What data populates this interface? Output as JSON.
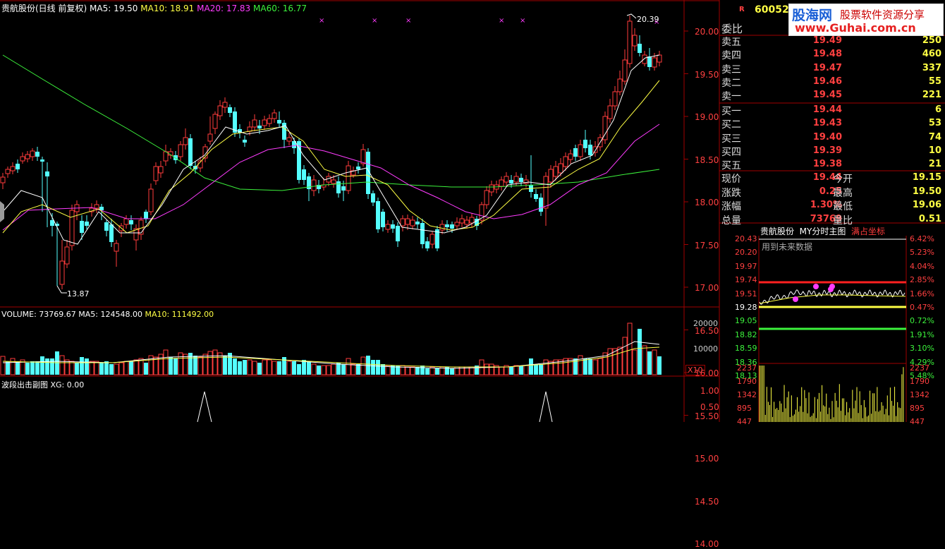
{
  "header": {
    "title": "贵航股份(日线 前复权)",
    "ma5": "MA5: 19.50",
    "ma10": "MA10: 18.91",
    "ma20": "MA20: 17.83",
    "ma60": "MA60: 16.77"
  },
  "price_axis": [
    "20.00",
    "19.50",
    "19.00",
    "18.50",
    "18.00",
    "17.50",
    "17.00",
    "16.50",
    "16.00",
    "15.50",
    "15.00",
    "14.50",
    "14.00"
  ],
  "annotations": {
    "high": "20.39",
    "low": "13.87"
  },
  "volume_header": {
    "volume": "VOLUME: 73769.67",
    "ma5": "MA5: 124548.00",
    "ma10": "MA10: 111492.00"
  },
  "volume_axis": [
    "20000",
    "10000"
  ],
  "volume_unit": "X10",
  "indicator_header": {
    "name": "波段出击副图",
    "value": "XG: 0.00"
  },
  "indicator_axis": [
    "1.00",
    "0.50"
  ],
  "stock_code": "60052",
  "r_mark": "R",
  "logo": {
    "brand": "股海网",
    "slogan": "股票软件资源分享",
    "url": "www.Guhai.com.cn"
  },
  "order_book": {
    "weibi_label": "委比",
    "sells": [
      {
        "label": "卖五",
        "price": "19.49",
        "vol": "250"
      },
      {
        "label": "卖四",
        "price": "19.48",
        "vol": "460"
      },
      {
        "label": "卖三",
        "price": "19.47",
        "vol": "337"
      },
      {
        "label": "卖二",
        "price": "19.46",
        "vol": "55"
      },
      {
        "label": "卖一",
        "price": "19.45",
        "vol": "221"
      }
    ],
    "buys": [
      {
        "label": "买一",
        "price": "19.44",
        "vol": "6"
      },
      {
        "label": "买二",
        "price": "19.43",
        "vol": "53"
      },
      {
        "label": "买三",
        "price": "19.40",
        "vol": "74"
      },
      {
        "label": "买四",
        "price": "19.39",
        "vol": "10"
      },
      {
        "label": "买五",
        "price": "19.38",
        "vol": "21"
      }
    ]
  },
  "stats": [
    {
      "l1": "现价",
      "v1": "19.44",
      "l2": "今开",
      "v2": "19.15"
    },
    {
      "l1": "涨跌",
      "v1": "0.25",
      "l2": "最高",
      "v2": "19.50"
    },
    {
      "l1": "涨幅",
      "v1": "1.30%",
      "l2": "最低",
      "v2": "19.06"
    },
    {
      "l1": "总量",
      "v1": "73769",
      "l2": "量比",
      "v2": "0.51"
    }
  ],
  "intraday": {
    "tabs": [
      "贵航股份",
      "MY分时主图",
      "满占坐标"
    ],
    "note": "用到未来数据",
    "left_axis": [
      "20.43",
      "20.20",
      "19.97",
      "19.74",
      "19.51",
      "19.28",
      "19.05",
      "18.82",
      "18.59",
      "18.36",
      "18.13"
    ],
    "right_axis": [
      "6.42%",
      "5.23%",
      "4.04%",
      "2.85%",
      "1.66%",
      "0.47%",
      "0.72%",
      "1.91%",
      "3.10%",
      "4.29%",
      "5.48%"
    ],
    "vol_axis": [
      "2237",
      "1790",
      "1342",
      "895",
      "447"
    ]
  },
  "colors": {
    "up": "#ff3c3c",
    "down": "#54ffff",
    "ma5": "#ffffff",
    "ma10": "#ffff44",
    "ma20": "#ff3cff",
    "ma60": "#3cf23c",
    "border": "#a00000"
  }
}
